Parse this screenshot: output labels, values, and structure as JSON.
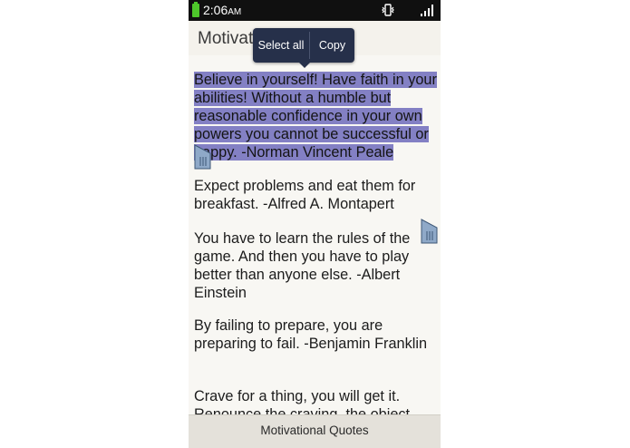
{
  "status_bar": {
    "time": "2:06",
    "ampm": "AM",
    "icons": [
      "battery-icon",
      "vibrate-icon",
      "signal-icon"
    ],
    "battery_color": "#4ec72b"
  },
  "app": {
    "title": "Motivational Quotes"
  },
  "context_menu": {
    "select_all_label": "Select all",
    "copy_label": "Copy"
  },
  "quotes": [
    {
      "text": "Believe in yourself! Have faith in your abilities! Without a humble but reasonable confidence in your own powers you cannot be successful or happy. -Norman Vincent Peale",
      "selected": true
    },
    {
      "text": "Expect problems and eat them for breakfast. -Alfred A. Montapert",
      "selected": false
    },
    {
      "text": "You have to learn the rules of the game. And then you have to play better than anyone else. -Albert Einstein",
      "selected": false
    },
    {
      "text": "By failing to prepare, you are preparing to fail. -Benjamin Franklin",
      "selected": false
    },
    {
      "text": "Crave for a thing, you will get it. Renounce the craving, the object",
      "selected": false
    }
  ],
  "bottom_bar": {
    "label": "Motivational Quotes"
  },
  "colors": {
    "selection": "#8380c4",
    "popup_bg": "#26304a",
    "handle": "#8fa9c8"
  }
}
